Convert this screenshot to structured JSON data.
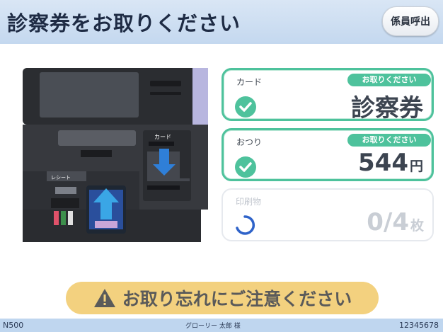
{
  "header": {
    "title": "診察券をお取りください",
    "call_button": "係員呼出"
  },
  "machine_image": {
    "card_slot_label": "カード",
    "receipt_label": "レシート",
    "icon": "kiosk-machine-illustration"
  },
  "items": [
    {
      "label": "カード",
      "status": "お取りください",
      "value": "診察券",
      "unit": "",
      "state": "done",
      "icon": "check-icon"
    },
    {
      "label": "おつり",
      "status": "お取りください",
      "value": "544",
      "unit": "円",
      "state": "done",
      "icon": "check-icon"
    },
    {
      "label": "印刷物",
      "status": "",
      "value": "0/4",
      "unit": "枚",
      "state": "pending",
      "icon": "spinner-icon"
    }
  ],
  "warning": {
    "text": "お取り忘れにご注意ください",
    "icon": "warning-icon"
  },
  "footer": {
    "left": "N500",
    "center": "グローリー 太郎 様",
    "right": "12345678"
  },
  "colors": {
    "header_bg": "#c4d8ef",
    "accent_green": "#4ec29c",
    "warning_bg": "#f3d17f",
    "footer_bg": "#bfd6ef"
  }
}
